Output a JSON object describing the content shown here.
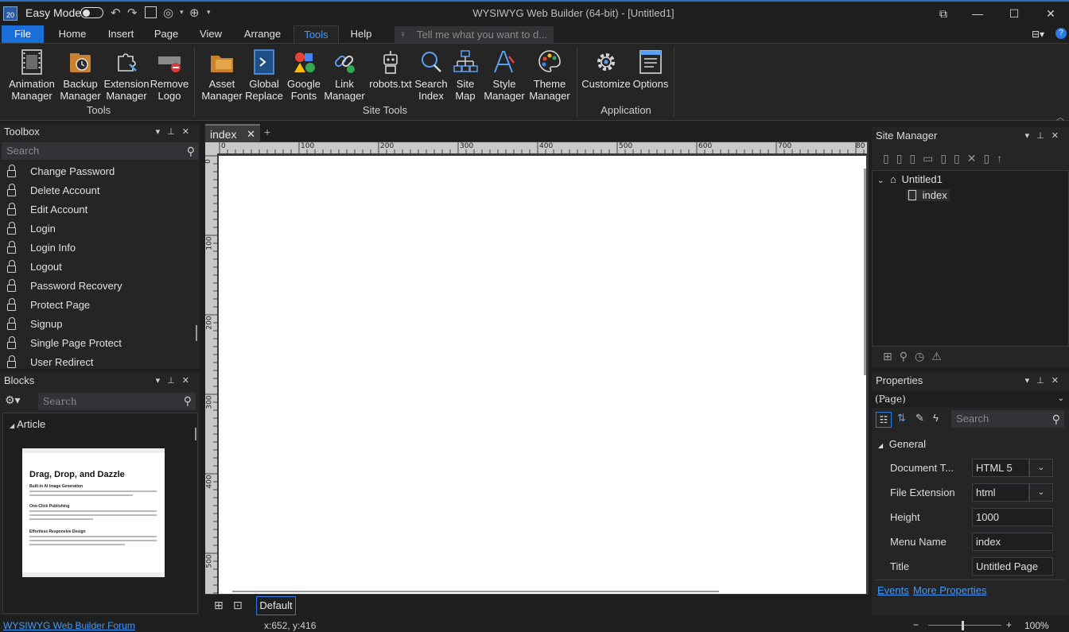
{
  "titlebar": {
    "app_icon_text": "20",
    "easy_mode_label": "Easy Mode",
    "window_title": "WYSIWYG Web Builder (64-bit) - [Untitled1]"
  },
  "menu": {
    "tabs": [
      "File",
      "Home",
      "Insert",
      "Page",
      "View",
      "Arrange",
      "Tools",
      "Help"
    ],
    "active_tab": "Tools",
    "tellme_placeholder": "Tell me what you want to d..."
  },
  "ribbon": {
    "groups": [
      {
        "label": "Tools",
        "buttons": [
          {
            "line1": "Animation",
            "line2": "Manager",
            "icon": "film-icon"
          },
          {
            "line1": "Backup",
            "line2": "Manager",
            "icon": "backup-icon"
          },
          {
            "line1": "Extension",
            "line2": "Manager",
            "icon": "puzzle-icon"
          },
          {
            "line1": "Remove",
            "line2": "Logo",
            "icon": "remove-logo-icon"
          }
        ]
      },
      {
        "label": "Site Tools",
        "buttons": [
          {
            "line1": "Asset",
            "line2": "Manager",
            "icon": "folder-icon"
          },
          {
            "line1": "Global",
            "line2": "Replace",
            "icon": "replace-icon"
          },
          {
            "line1": "Google",
            "line2": "Fonts",
            "icon": "google-fonts-icon"
          },
          {
            "line1": "Link",
            "line2": "Manager",
            "icon": "link-icon"
          },
          {
            "line1": "robots.txt",
            "line2": "",
            "icon": "robot-icon"
          },
          {
            "line1": "Search",
            "line2": "Index",
            "icon": "search-index-icon"
          },
          {
            "line1": "Site",
            "line2": "Map",
            "icon": "sitemap-icon"
          },
          {
            "line1": "Style",
            "line2": "Manager",
            "icon": "style-icon"
          },
          {
            "line1": "Theme",
            "line2": "Manager",
            "icon": "palette-icon"
          }
        ]
      },
      {
        "label": "Application",
        "buttons": [
          {
            "line1": "Customize",
            "line2": "",
            "icon": "gear-icon"
          },
          {
            "line1": "Options",
            "line2": "",
            "icon": "options-icon"
          }
        ]
      }
    ]
  },
  "toolbox": {
    "title": "Toolbox",
    "search_placeholder": "Search",
    "items": [
      "Change Password",
      "Delete Account",
      "Edit Account",
      "Login",
      "Login Info",
      "Logout",
      "Password Recovery",
      "Protect Page",
      "Signup",
      "Single Page Protect",
      "User Redirect"
    ]
  },
  "blocks": {
    "title": "Blocks",
    "search_placeholder": "Search",
    "category": "Article",
    "preview": {
      "heading": "Drag, Drop, and Dazzle",
      "sub1": "Built-in AI Image Generation",
      "sub2": "One-Click Publishing",
      "sub3": "Effortless Responsive Design"
    }
  },
  "editor": {
    "doc_tab": "index",
    "add_tab": "+",
    "ruler_h": [
      "0",
      "100",
      "200",
      "300",
      "400",
      "500",
      "600",
      "700",
      "80"
    ],
    "ruler_v": [
      "0",
      "100",
      "200",
      "300",
      "400",
      "500"
    ],
    "breakpoint": "Default"
  },
  "site_manager": {
    "title": "Site Manager",
    "root": "Untitled1",
    "page": "index"
  },
  "properties": {
    "title": "Properties",
    "object": "(Page)",
    "search_placeholder": "Search",
    "section": "General",
    "rows": [
      {
        "key": "Document T...",
        "value": "HTML 5",
        "dropdown": true
      },
      {
        "key": "File Extension",
        "value": "html",
        "dropdown": true
      },
      {
        "key": "Height",
        "value": "1000",
        "dropdown": false
      },
      {
        "key": "Menu Name",
        "value": "index",
        "dropdown": false
      },
      {
        "key": "Title",
        "value": "Untitled Page",
        "dropdown": false
      }
    ],
    "events_link": "Events",
    "more_link": "More Properties"
  },
  "status": {
    "forum_link": "WYSIWYG Web Builder Forum",
    "coords": "x:652, y:416",
    "zoom": "100%",
    "zoom_minus": "−",
    "zoom_plus": "+"
  },
  "colors": {
    "accent": "#1a6ed8",
    "link": "#3d9bff",
    "background": "#1e1e1e",
    "panel": "#252526"
  }
}
